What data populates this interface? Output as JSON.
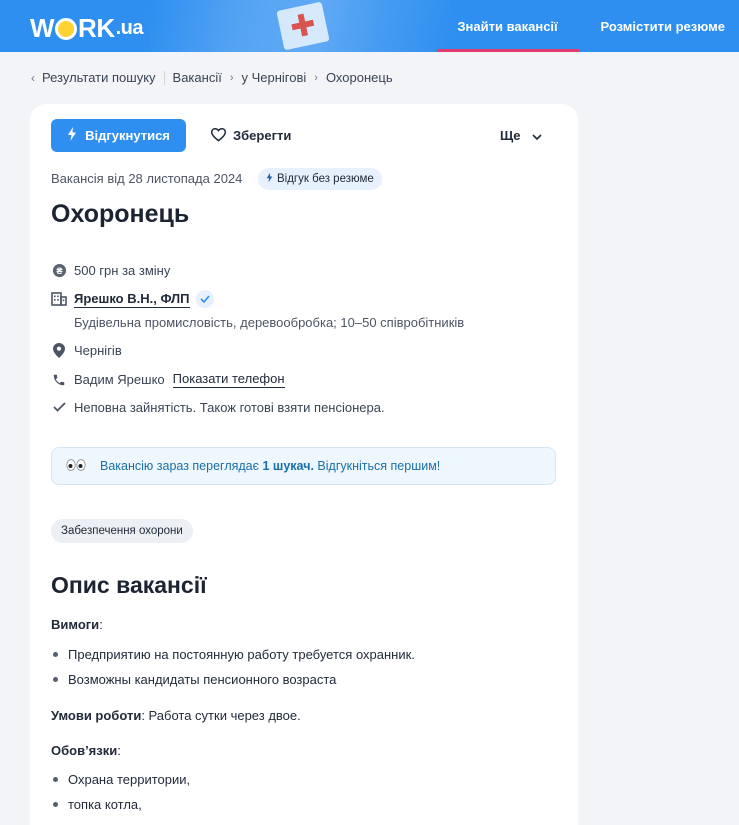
{
  "header": {
    "logo": {
      "part1": "W",
      "part2": "RK",
      "part3": ".ua"
    },
    "nav": [
      {
        "label": "Знайти вакансії",
        "active": true
      },
      {
        "label": "Розмістити резюме",
        "active": false
      }
    ]
  },
  "breadcrumb": {
    "back": "Результати пошуку",
    "items": [
      "Вакансії",
      "у Чернігові",
      "Охоронець"
    ]
  },
  "actions": {
    "apply": "Відгукнутися",
    "save": "Зберегти",
    "more": "Ще"
  },
  "vacancy": {
    "posted": "Вакансія від 28 листопада 2024",
    "badge": "Відгук без резюме",
    "title": "Охоронець",
    "salary": "500 грн за зміну",
    "company": "Ярешко В.Н., ФЛП",
    "company_info": "Будівельна промисловість, деревообробка; 10–50 співробітників",
    "city": "Чернігів",
    "contact_name": "Вадим Ярешко",
    "show_phone": "Показати телефон",
    "employment": "Неповна зайнятість. Також готові взяти пенсіонера."
  },
  "notice": {
    "prefix": "Вакансію зараз переглядає",
    "count": "1 шукач.",
    "suffix": "Відгукніться першим!"
  },
  "tag": "Забезпечення охорони",
  "description": {
    "heading": "Опис вакансії",
    "requirements_label": "Вимоги",
    "colon": ":",
    "requirements": [
      "Предприятию на постоянную работу требуется охранник.",
      "Возможны кандидаты пенсионного возраста"
    ],
    "conditions_label": "Умови роботи",
    "conditions_text": " Работа сутки через двое.",
    "duties_label": "Обов’язки",
    "duties": [
      "Охрана территории,",
      "топка котла,"
    ]
  },
  "colors": {
    "brand": "#2e8ff0",
    "accent": "#e23b6d",
    "notice_text": "#1a6fa8"
  }
}
